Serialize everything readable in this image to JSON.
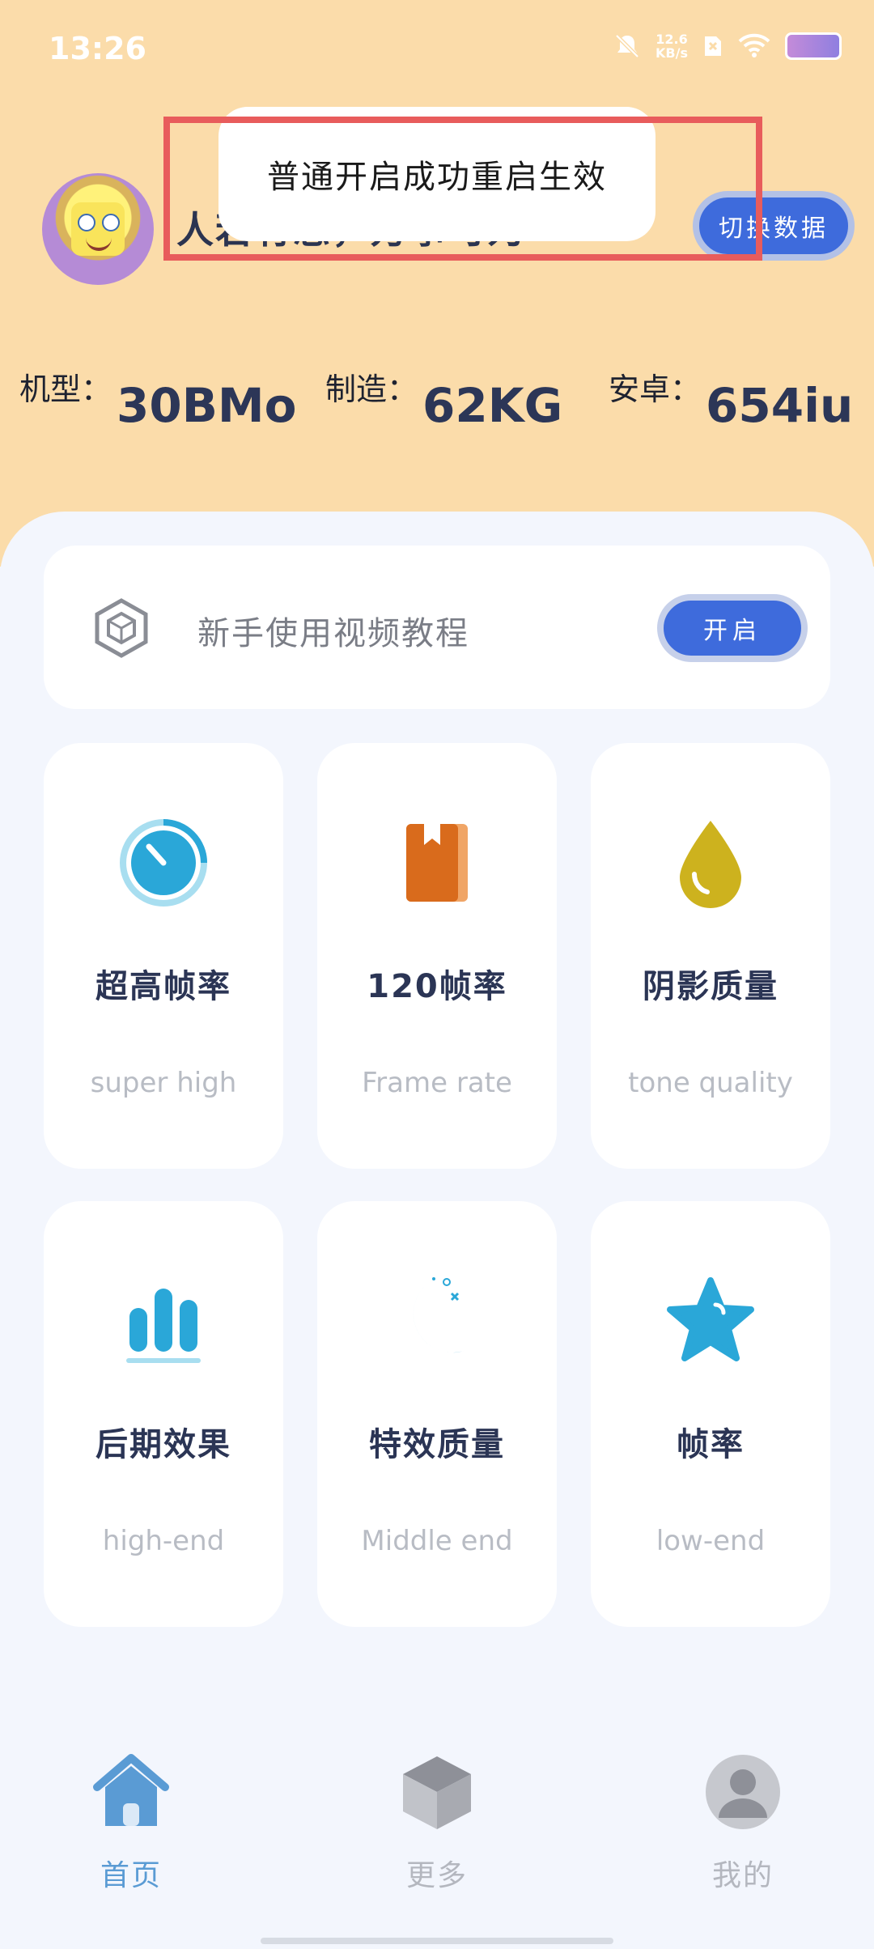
{
  "status_bar": {
    "time": "13:26",
    "network_speed_value": "12.6",
    "network_speed_unit": "KB/s"
  },
  "header": {
    "username": "人若有志，万事可为",
    "switch_button": "切换数据"
  },
  "toast": {
    "message": "普通开启成功重启生效"
  },
  "stats": [
    {
      "label": "机型：",
      "value": "30BMo"
    },
    {
      "label": "制造：",
      "value": "62KG"
    },
    {
      "label": "安卓：",
      "value": "654iu"
    }
  ],
  "tutorial": {
    "text": "新手使用视频教程",
    "button": "开启"
  },
  "cards": [
    {
      "title": "超高帧率",
      "subtitle": "super high",
      "icon": "gauge-icon"
    },
    {
      "title": "120帧率",
      "subtitle": "Frame rate",
      "icon": "book-icon"
    },
    {
      "title": "阴影质量",
      "subtitle": "tone quality",
      "icon": "droplet-icon"
    },
    {
      "title": "后期效果",
      "subtitle": "high-end",
      "icon": "bar-chart-icon"
    },
    {
      "title": "特效质量",
      "subtitle": "Middle end",
      "icon": "moon-icon"
    },
    {
      "title": "帧率",
      "subtitle": "low-end",
      "icon": "star-icon"
    }
  ],
  "nav": [
    {
      "label": "首页",
      "icon": "home-icon",
      "active": true
    },
    {
      "label": "更多",
      "icon": "cube-icon",
      "active": false
    },
    {
      "label": "我的",
      "icon": "user-icon",
      "active": false
    }
  ],
  "colors": {
    "accent": "#3e6bdc",
    "header_bg": "#fbdcaa",
    "active_nav": "#5a9bd4",
    "inactive_nav": "#b4b7bf",
    "highlight": "#e85c5c"
  }
}
